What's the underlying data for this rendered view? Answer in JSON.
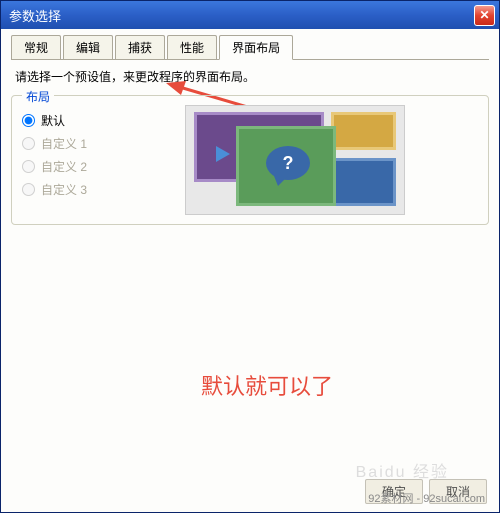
{
  "window": {
    "title": "参数选择"
  },
  "tabs": {
    "items": [
      {
        "label": "常规"
      },
      {
        "label": "编辑"
      },
      {
        "label": "捕获"
      },
      {
        "label": "性能"
      },
      {
        "label": "界面布局"
      }
    ],
    "active_index": 4
  },
  "instruction": "请选择一个预设值，来更改程序的界面布局。",
  "layout": {
    "legend": "布局",
    "options": [
      {
        "label": "默认",
        "checked": true,
        "enabled": true
      },
      {
        "label": "自定义 1",
        "checked": false,
        "enabled": false
      },
      {
        "label": "自定义 2",
        "checked": false,
        "enabled": false
      },
      {
        "label": "自定义 3",
        "checked": false,
        "enabled": false
      }
    ],
    "preview_question": "?"
  },
  "annotation": "默认就可以了",
  "buttons": {
    "ok": "确定",
    "cancel": "取消"
  },
  "watermark_bg": "Baidu 经验",
  "watermark": "92素材网 - 92sucai.com"
}
